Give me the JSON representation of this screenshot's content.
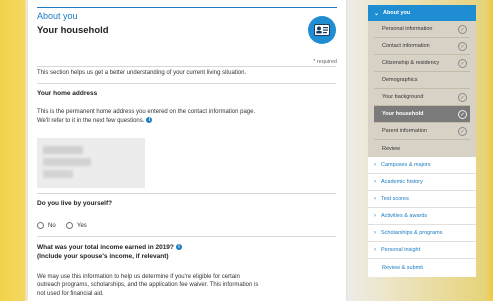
{
  "header": {
    "section_label": "About you",
    "page_title": "Your household",
    "required_note": "* required"
  },
  "intro": "This section helps us get a better understanding of your current living situation.",
  "home_address": {
    "title": "Your home address",
    "body_line1": "This is the permanent home address you entered on the contact information page.",
    "body_line2": "We'll refer to it in the next few questions."
  },
  "live_alone": {
    "question": "Do you live by yourself?",
    "options": [
      "No",
      "Yes"
    ]
  },
  "income": {
    "question_line1": "What was your total income earned in 2019?",
    "question_line2": "(Include your spouse's income, if relevant)",
    "body_line1": "We may use this information to help us determine if you're eligible for certain",
    "body_line2": "outreach programs, scholarships, and the application fee waiver. This information is",
    "body_line3": "not used for financial aid."
  },
  "sidebar": {
    "section": "About you",
    "sub_items": [
      {
        "label": "Personal information",
        "checked": true
      },
      {
        "label": "Contact information",
        "checked": true
      },
      {
        "label": "Citizenship & residency",
        "checked": true
      },
      {
        "label": "Demographics",
        "checked": false
      },
      {
        "label": "Your background",
        "checked": true
      },
      {
        "label": "Your household",
        "checked": true,
        "active": true
      },
      {
        "label": "Parent information",
        "checked": true
      },
      {
        "label": "Review",
        "checked": false
      }
    ],
    "top_items": [
      {
        "label": "Campuses & majors",
        "expandable": true
      },
      {
        "label": "Academic history",
        "expandable": true
      },
      {
        "label": "Test scores",
        "expandable": true
      },
      {
        "label": "Activities & awards",
        "expandable": true
      },
      {
        "label": "Scholarships & programs",
        "expandable": true
      },
      {
        "label": "Personal insight",
        "expandable": true
      },
      {
        "label": "Review & submit",
        "expandable": false
      }
    ]
  },
  "colors": {
    "accent": "#1b7cc1",
    "sidebar_header": "#1e8dd2",
    "active_item": "#7a7a7a"
  }
}
